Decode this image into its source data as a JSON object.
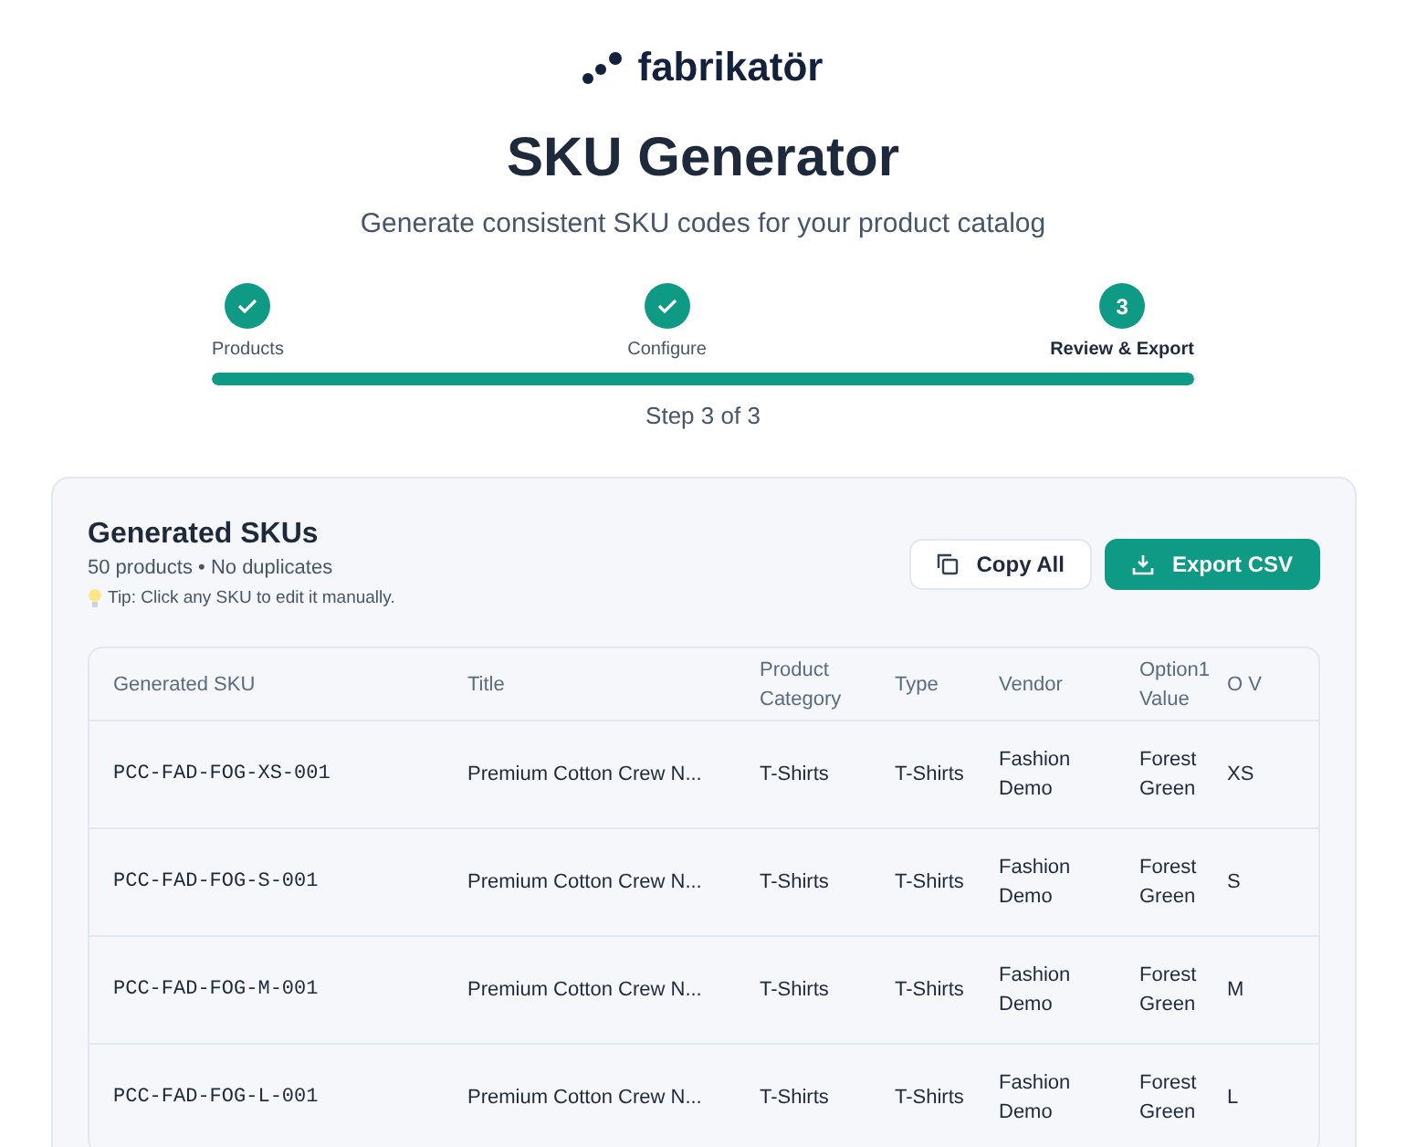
{
  "logo": {
    "text": "fabrikatör"
  },
  "header": {
    "title": "SKU Generator",
    "subtitle": "Generate consistent SKU codes for your product catalog"
  },
  "stepper": {
    "steps": [
      {
        "label": "Products",
        "completed": true,
        "selected": false
      },
      {
        "label": "Configure",
        "completed": true,
        "selected": false
      },
      {
        "label": "Review & Export",
        "number": "3",
        "completed": false,
        "selected": true
      }
    ],
    "level": 1,
    "caption": "Step 3 of 3"
  },
  "card": {
    "title": "Generated SKUs",
    "summary": "50 products • No duplicates",
    "tip": "Tip: Click any SKU to edit it manually.",
    "buttons": [
      {
        "label": "Copy All",
        "kind": "secondary"
      },
      {
        "label": "Export CSV",
        "kind": "primary"
      }
    ]
  },
  "table": {
    "columns": [
      "Generated SKU",
      "Title",
      "Product Category",
      "Type",
      "Vendor",
      "Option1 Value",
      "O V"
    ],
    "rows": [
      [
        "PCC-FAD-FOG-XS-001",
        "Premium Cotton Crew N...",
        "T-Shirts",
        "T-Shirts",
        "Fashion Demo",
        "Forest Green",
        "XS"
      ],
      [
        "PCC-FAD-FOG-S-001",
        "Premium Cotton Crew N...",
        "T-Shirts",
        "T-Shirts",
        "Fashion Demo",
        "Forest Green",
        "S"
      ],
      [
        "PCC-FAD-FOG-M-001",
        "Premium Cotton Crew N...",
        "T-Shirts",
        "T-Shirts",
        "Fashion Demo",
        "Forest Green",
        "M"
      ],
      [
        "PCC-FAD-FOG-L-001",
        "Premium Cotton Crew N...",
        "T-Shirts",
        "T-Shirts",
        "Fashion Demo",
        "Forest Green",
        "L"
      ]
    ]
  }
}
